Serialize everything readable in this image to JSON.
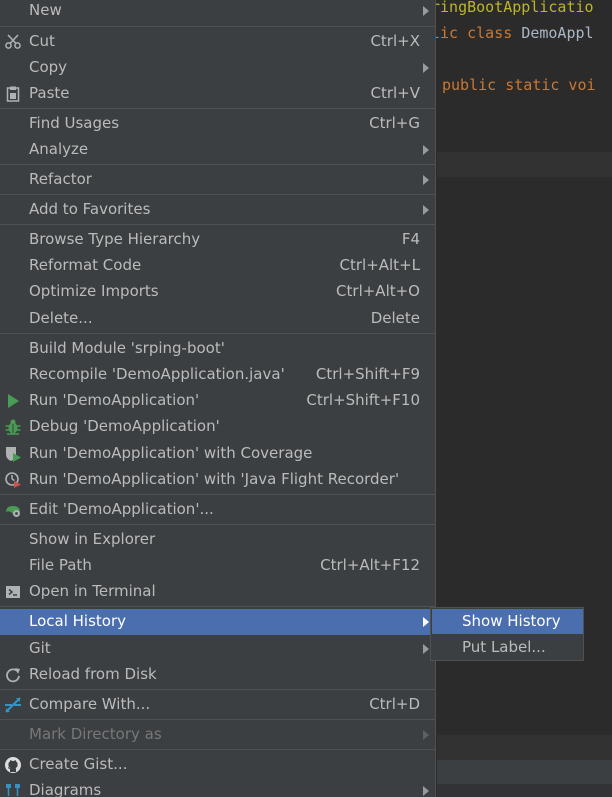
{
  "editor": {
    "line1": "ringBootApplicatio",
    "line2_kw": "lic class ",
    "line2_id": "DemoAppl",
    "line3": "public static voi"
  },
  "menu": {
    "new": "New",
    "cut": "Cut",
    "cut_sc": "Ctrl+X",
    "copy": "Copy",
    "paste": "Paste",
    "paste_sc": "Ctrl+V",
    "find_usages": "Find Usages",
    "find_usages_sc": "Ctrl+G",
    "analyze": "Analyze",
    "refactor": "Refactor",
    "add_to_favorites": "Add to Favorites",
    "browse_type_hierarchy": "Browse Type Hierarchy",
    "browse_type_hierarchy_sc": "F4",
    "reformat_code": "Reformat Code",
    "reformat_code_sc": "Ctrl+Alt+L",
    "optimize_imports": "Optimize Imports",
    "optimize_imports_sc": "Ctrl+Alt+O",
    "delete": "Delete...",
    "delete_sc": "Delete",
    "build_module": "Build Module 'srping-boot'",
    "recompile": "Recompile 'DemoApplication.java'",
    "recompile_sc": "Ctrl+Shift+F9",
    "run": "Run 'DemoApplication'",
    "run_sc": "Ctrl+Shift+F10",
    "debug": "Debug 'DemoApplication'",
    "run_coverage": "Run 'DemoApplication' with Coverage",
    "run_jfr": "Run 'DemoApplication' with 'Java Flight Recorder'",
    "edit_config": "Edit 'DemoApplication'...",
    "show_in_explorer": "Show in Explorer",
    "file_path": "File Path",
    "file_path_sc": "Ctrl+Alt+F12",
    "open_in_terminal": "Open in Terminal",
    "local_history": "Local History",
    "git": "Git",
    "reload_from_disk": "Reload from Disk",
    "compare_with": "Compare With...",
    "compare_with_sc": "Ctrl+D",
    "mark_directory_as": "Mark Directory as",
    "create_gist": "Create Gist...",
    "diagrams": "Diagrams"
  },
  "submenu": {
    "show_history": "Show History",
    "put_label": "Put Label..."
  },
  "colors": {
    "menu_bg": "#3c3f41",
    "selection": "#4b6eaf",
    "text": "#bbbbbb",
    "disabled_text": "#777777",
    "run_green": "#499c54"
  }
}
